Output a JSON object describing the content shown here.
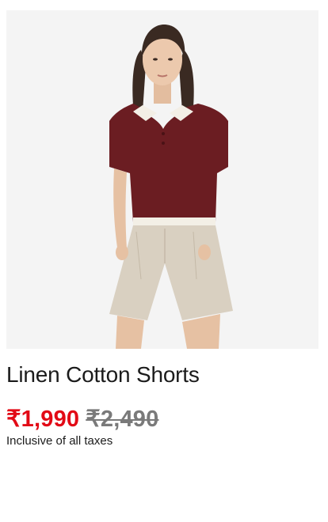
{
  "product": {
    "name": "Linen Cotton Shorts",
    "price_sale": "₹1,990",
    "price_original": "₹2,490",
    "tax_note": "Inclusive of all taxes"
  },
  "image": {
    "background_color": "#f4f4f4",
    "top_color": "#6b1d22",
    "collar_color": "#f3efe6",
    "shorts_color": "#d9d0c1",
    "skin_color": "#e8c4a8",
    "hair_color": "#3a2a22"
  },
  "colors": {
    "sale_price": "#e20a16",
    "original_price": "#7a7a7a",
    "text": "#1b1b1b"
  }
}
